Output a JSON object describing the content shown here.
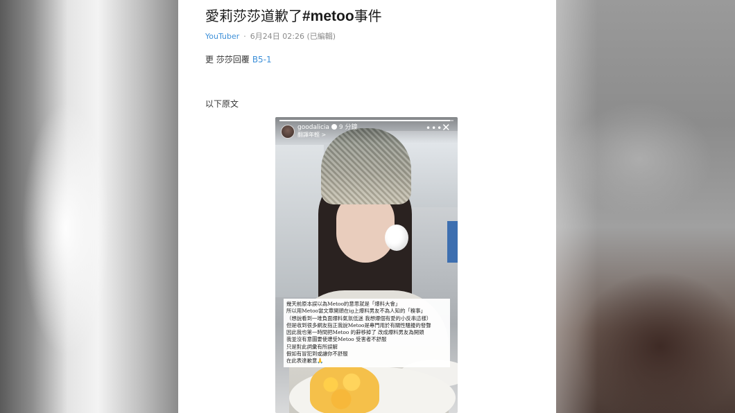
{
  "post": {
    "title": "愛莉莎莎道歉了",
    "title_tag": "#metoo",
    "title_suffix": "事件",
    "board": "YouTuber",
    "separator": "·",
    "timestamp": "6月24日 02:26 (已編輯)",
    "update_prefix": "更 莎莎回覆",
    "update_link": "B5-1",
    "original_label": "以下原文"
  },
  "story": {
    "username": "goodalicia",
    "time": "9 分鐘",
    "subtitle": "翻譯年輕 >",
    "progress": 0.98,
    "caption_lines": [
      "幾天前原本誤以為Metoo的意思就是「爆料大會」",
      "所以用Metoo當文章開頭在ig上爆料男友不為人知的「糗事」",
      "（想說看到一堆負面爆料氣氛低迷 我想爆個有愛的小反串這樣）",
      "但是收到很多網友指正我說Metoo是專門用於有關性騷擾的發聲",
      "因此我也第一時間把Metoo 的辭移掉了 改成爆料男友為開頭",
      "我並沒有意圖要使遭受Metoo 受害者不舒服",
      "只是對此詞彙有所誤解",
      "假如有冒犯到或讓你不舒服",
      "在此表達歉意🙏"
    ]
  },
  "icons": {
    "more": "more-horizontal-icon",
    "close": "close-icon",
    "verified": "verified-badge-icon"
  },
  "colors": {
    "link": "#3c8fd8",
    "meta": "#8a8a8a",
    "text": "#1a1a1a"
  }
}
